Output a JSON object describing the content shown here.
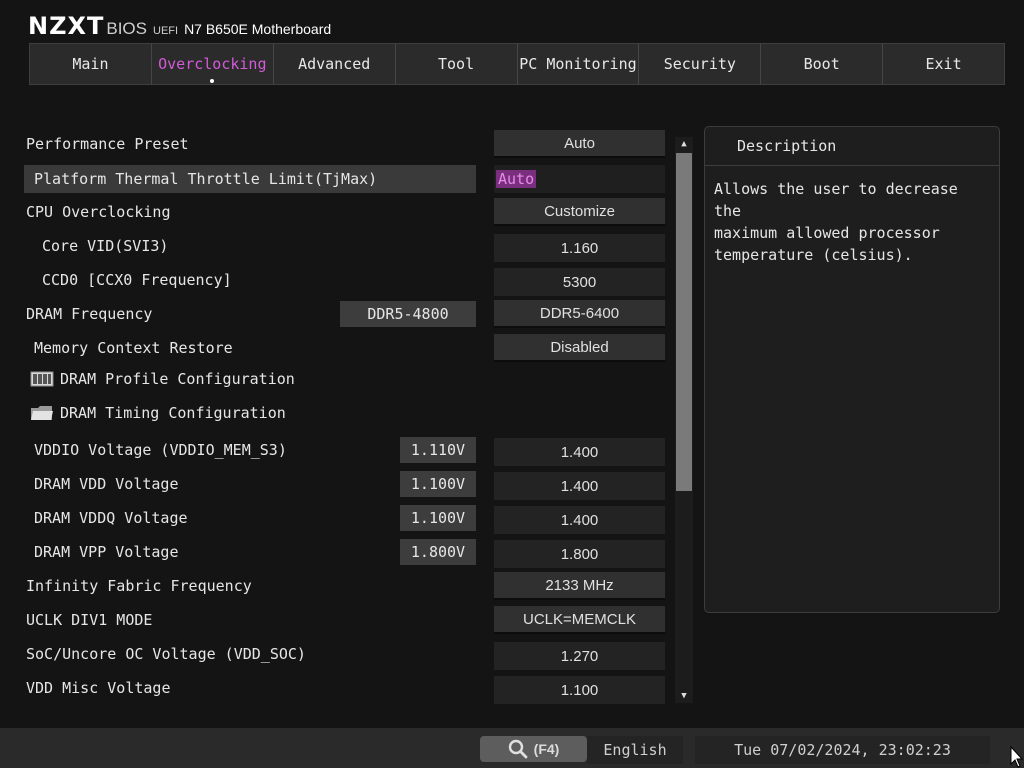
{
  "brand": {
    "logo": "NZXT",
    "bios": "BIOS",
    "uefi": "UEFI",
    "model": "N7 B650E Motherboard"
  },
  "tabs": [
    "Main",
    "Overclocking",
    "Advanced",
    "Tool",
    "PC Monitoring",
    "Security",
    "Boot",
    "Exit"
  ],
  "active_tab": "Overclocking",
  "settings": {
    "performance_preset": {
      "label": "Performance Preset",
      "value": "Auto"
    },
    "thermal_limit": {
      "label": "Platform Thermal Throttle Limit(TjMax)",
      "value": "Auto"
    },
    "cpu_oc": {
      "label": "CPU Overclocking",
      "value": "Customize"
    },
    "core_vid": {
      "label": "Core VID(SVI3)",
      "value": "1.160"
    },
    "ccd0_freq": {
      "label": "CCD0 [CCX0 Frequency]",
      "value": "5300"
    },
    "dram_freq": {
      "label": "DRAM Frequency",
      "current": "DDR5-4800",
      "value": "DDR5-6400"
    },
    "mem_context": {
      "label": "Memory Context Restore",
      "value": "Disabled"
    },
    "dram_profile": {
      "label": "DRAM Profile Configuration",
      "icon": "memory-module-icon"
    },
    "dram_timing": {
      "label": "DRAM Timing Configuration",
      "icon": "folder-icon"
    },
    "vddio": {
      "label": "VDDIO Voltage (VDDIO_MEM_S3)",
      "current": "1.110V",
      "value": "1.400"
    },
    "dram_vdd": {
      "label": "DRAM VDD Voltage",
      "current": "1.100V",
      "value": "1.400"
    },
    "dram_vddq": {
      "label": "DRAM VDDQ Voltage",
      "current": "1.100V",
      "value": "1.400"
    },
    "dram_vpp": {
      "label": "DRAM VPP Voltage",
      "current": "1.800V",
      "value": "1.800"
    },
    "if_freq": {
      "label": "Infinity Fabric Frequency",
      "value": "2133 MHz"
    },
    "uclk_mode": {
      "label": "UCLK DIV1 MODE",
      "value": "UCLK=MEMCLK"
    },
    "soc_voltage": {
      "label": "SoC/Uncore OC Voltage (VDD_SOC)",
      "value": "1.270"
    },
    "vdd_misc": {
      "label": "VDD Misc Voltage",
      "value": "1.100"
    }
  },
  "description": {
    "title": "Description",
    "text": "Allows the user to decrease the\nmaximum allowed processor\ntemperature (celsius)."
  },
  "bottom": {
    "search_label": "(F4)",
    "language": "English",
    "datetime": "Tue 07/02/2024, 23:02:23"
  },
  "colors": {
    "accent": "#d35ad8",
    "background": "#141414",
    "panel": "#1e1e1e"
  }
}
